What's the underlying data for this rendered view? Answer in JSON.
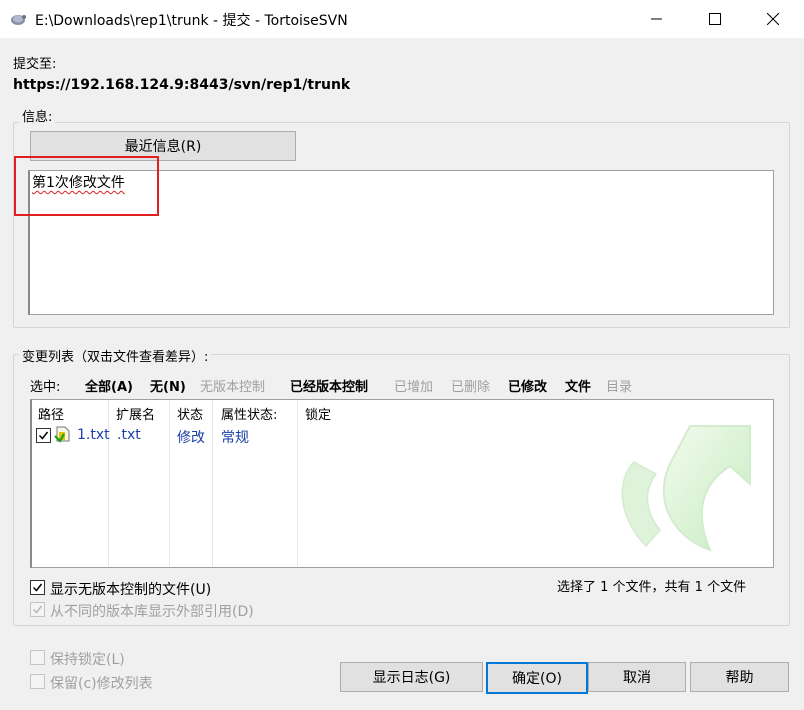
{
  "window": {
    "title": "E:\\Downloads\\rep1\\trunk - 提交 - TortoiseSVN"
  },
  "commit_to": {
    "label": "提交至:",
    "url": "https://192.168.124.9:8443/svn/rep1/trunk"
  },
  "message": {
    "group_label": "信息:",
    "recent_button": "最近信息(R)",
    "text": "第1次修改文件"
  },
  "changes": {
    "group_label": "变更列表（双击文件查看差异）:",
    "select_label": "选中:",
    "filters": [
      {
        "label": "全部(A)",
        "enabled": true
      },
      {
        "label": "无(N)",
        "enabled": true
      },
      {
        "label": "无版本控制",
        "enabled": false
      },
      {
        "label": "已经版本控制",
        "enabled": true
      },
      {
        "label": "已增加",
        "enabled": false
      },
      {
        "label": "已删除",
        "enabled": false
      },
      {
        "label": "已修改",
        "enabled": true
      },
      {
        "label": "文件",
        "enabled": true
      },
      {
        "label": "目录",
        "enabled": false
      }
    ],
    "columns": [
      "路径",
      "扩展名",
      "状态",
      "属性状态:",
      "锁定"
    ],
    "rows": [
      {
        "checked": true,
        "path": "1.txt",
        "ext": ".txt",
        "status": "修改",
        "prop_status": "常规",
        "lock": ""
      }
    ],
    "show_unversioned": {
      "label": "显示无版本控制的文件(U)",
      "checked": true
    },
    "show_externals": {
      "label": "从不同的版本库显示外部引用(D)",
      "checked": true,
      "enabled": false
    },
    "summary": "选择了 1 个文件，共有 1 个文件"
  },
  "options": {
    "keep_locks": {
      "label": "保持锁定(L)",
      "checked": false,
      "enabled": false
    },
    "keep_changelist": {
      "label": "保留(c)修改列表",
      "checked": false,
      "enabled": false
    }
  },
  "buttons": {
    "show_log": "显示日志(G)",
    "ok": "确定(O)",
    "cancel": "取消",
    "help": "帮助"
  }
}
